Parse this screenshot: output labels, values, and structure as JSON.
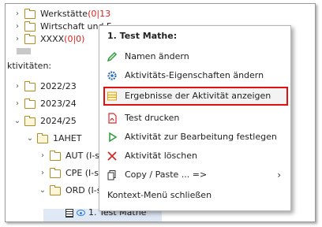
{
  "tree": {
    "clipped_top": "… …",
    "top_items": [
      {
        "label": "Werkstätte ",
        "count": "(0|13"
      },
      {
        "label": "Wirtschaft und F",
        "count": ""
      },
      {
        "label": "XXXX ",
        "count": "(0|0)"
      }
    ],
    "section_label": "ktivitäten:",
    "years": [
      "2022/23",
      "2023/24",
      "2024/25"
    ],
    "class_label": "1AHET",
    "subjects": [
      "AUT (I-spir",
      "CPE (I-spir",
      "ORD (I-spi"
    ],
    "selected_item": "1. Test Mathe"
  },
  "context_menu": {
    "title": "1. Test Mathe:",
    "items": [
      {
        "label": "Namen ändern",
        "icon": "pencil-icon"
      },
      {
        "label": "Aktivitäts-Eigenschaften ändern",
        "icon": "gear-icon"
      },
      {
        "label": "Ergebnisse der Aktivität anzeigen",
        "icon": "table-icon"
      },
      {
        "label": "Test drucken",
        "icon": "pdf-icon"
      },
      {
        "label": "Aktivität zur Bearbeitung festlegen",
        "icon": "play-icon"
      },
      {
        "label": "Aktivität löschen",
        "icon": "delete-x-icon"
      },
      {
        "label": "Copy / Paste ... =>",
        "icon": "copy-icon"
      },
      {
        "label": "Kontext-Menü schließen",
        "icon": ""
      }
    ]
  },
  "colors": {
    "highlight_border": "#e01010",
    "count_red": "#e02020",
    "folder": "#b48c20"
  }
}
